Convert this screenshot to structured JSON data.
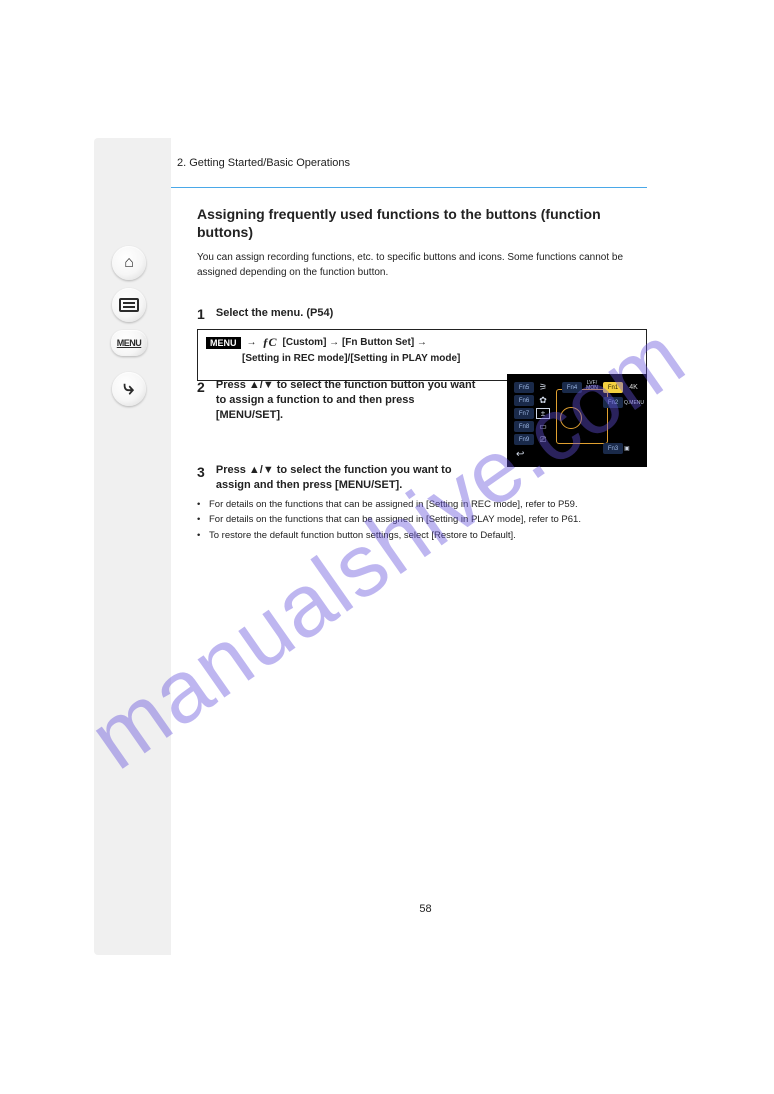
{
  "watermark": "manualshive.com",
  "nav": {
    "home_icon": "⌂",
    "menu_label": "MENU",
    "back_icon": "↶"
  },
  "header": {
    "breadcrumb": "2. Getting Started/Basic Operations"
  },
  "section": {
    "title": "Assigning frequently used functions to the buttons (function buttons)",
    "intro": "You can assign recording functions, etc. to specific buttons and icons. Some functions cannot be assigned depending on the function button."
  },
  "steps": {
    "s1_num": "1",
    "s1_text": "Select the menu. (P54)",
    "menu_tag": "MENU",
    "menu_custom": "ƒC",
    "menu_path_1": " [Custom] → [Fn Button Set] →",
    "menu_path_2": "[Setting in REC mode]/[Setting in PLAY mode]",
    "s2_num": "2",
    "s2_text": "Press ▲/▼ to select the function button you want to assign a function to and then press [MENU/SET].",
    "s3_num": "3",
    "s3_text": "Press ▲/▼ to select the function you want to assign and then press [MENU/SET]."
  },
  "notes": {
    "n1": "For details on the functions that can be assigned in [Setting in REC mode], refer to P59.",
    "n2": "For details on the functions that can be assigned in [Setting in PLAY mode], refer to P61.",
    "n3": "To restore the default function button settings, select [Restore to Default]."
  },
  "lcd": {
    "fn1": "Fn1",
    "fn2": "Fn2",
    "fn3": "Fn3",
    "fn4": "Fn4",
    "fn5": "Fn5",
    "fn6": "Fn6",
    "fn7": "Fn7",
    "fn8": "Fn8",
    "fn9": "Fn9",
    "lvf_mon_1": "LVF/",
    "lvf_mon_2": "MON",
    "raw": "Q.MENU",
    "fn1_label": "4K",
    "fn3_label": "▣",
    "wifi_icon": "⚞",
    "q_icon": "✿",
    "i_icon": "±",
    "hist_icon": "▭",
    "preview_icon": "⎚",
    "back": "↩"
  },
  "page_number": "58"
}
